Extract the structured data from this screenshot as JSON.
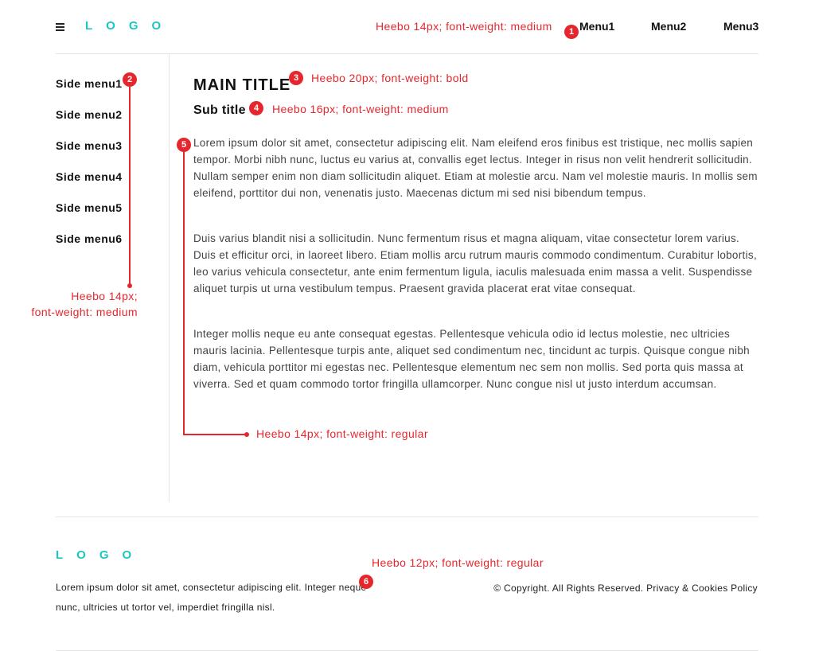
{
  "header": {
    "logo": "LOGO",
    "menu_icon": "hamburger-menu-icon",
    "nav": [
      "Menu1",
      "Menu2",
      "Menu3"
    ]
  },
  "sidebar": {
    "items": [
      "Side menu1",
      "Side menu2",
      "Side menu3",
      "Side menu4",
      "Side menu5",
      "Side menu6"
    ]
  },
  "main": {
    "title": "MAIN TITLE",
    "subtitle": "Sub title",
    "paragraphs": [
      "Lorem ipsum dolor sit amet, consectetur adipiscing elit. Nam eleifend eros finibus est tristique, nec mollis sapien tempor. Morbi nibh nunc, luctus eu varius at, convallis eget lectus. Integer in risus non velit hendrerit sollicitudin. Nullam semper enim non diam sollicitudin aliquet. Etiam at molestie arcu. Nam vel molestie mauris. In mollis sem eleifend, porttitor dui non, venenatis justo. Maecenas dictum mi sed nisi bibendum tempus.",
      "Duis varius blandit nisi a sollicitudin. Nunc fermentum risus et magna aliquam, vitae consectetur lorem varius. Duis et efficitur orci, in laoreet libero. Etiam mollis arcu rutrum mauris commodo condimentum. Curabitur lobortis, leo varius vehicula consectetur, ante enim fermentum ligula, iaculis malesuada enim massa a velit. Suspendisse aliquet turpis ut urna vestibulum tempus. Praesent gravida placerat erat vitae consequat.",
      "Integer mollis neque eu ante consequat egestas. Pellentesque vehicula odio id lectus molestie, nec ultricies mauris lacinia. Pellentesque turpis ante, aliquet sed condimentum nec, tincidunt ac turpis. Quisque congue nibh diam, vehicula porttitor mi egestas nec. Pellentesque elementum nec sem non mollis. Sed porta quis massa at viverra. Sed et quam commodo tortor fringilla ullamcorper. Nunc congue nisl ut justo interdum accumsan."
    ]
  },
  "footer": {
    "logo": "LOGO",
    "text": "Lorem ipsum dolor sit amet, consectetur adipiscing elit. Integer neque nunc, ultricies ut tortor vel, imperdiet fringilla nisl.",
    "copyright": "© Copyright. All Rights Reserved.",
    "policy_link": "Privacy & Cookies Policy"
  },
  "annotations": {
    "n1": {
      "badge": "1",
      "text": "Heebo 14px; font-weight: medium"
    },
    "n2": {
      "badge": "2",
      "text_line1": "Heebo 14px;",
      "text_line2": "font-weight: medium"
    },
    "n3": {
      "badge": "3",
      "text": "Heebo 20px; font-weight: bold"
    },
    "n4": {
      "badge": "4",
      "text": "Heebo 16px; font-weight: medium"
    },
    "n5": {
      "badge": "5",
      "text": "Heebo 14px; font-weight: regular"
    },
    "n6": {
      "badge": "6",
      "text": "Heebo 12px; font-weight: regular"
    }
  },
  "colors": {
    "accent": "#1cc7c2",
    "annotation": "#e5272d",
    "divider": "#e6e6e6"
  }
}
